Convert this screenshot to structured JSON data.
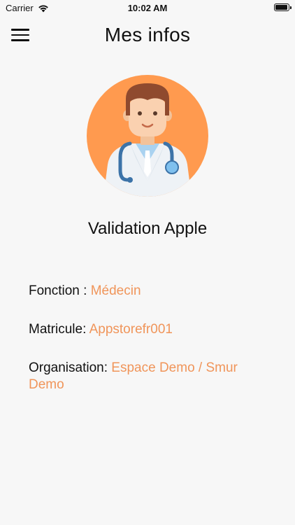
{
  "status_bar": {
    "carrier": "Carrier",
    "time": "10:02 AM"
  },
  "header": {
    "title": "Mes infos",
    "menu_icon": "hamburger-menu-icon"
  },
  "profile": {
    "avatar_icon": "doctor-avatar-icon",
    "name": "Validation Apple"
  },
  "info": {
    "fonction_label": "Fonction : ",
    "fonction_value": "Médecin",
    "matricule_label": "Matricule: ",
    "matricule_value": "Appstorefr001",
    "organisation_label": "Organisation: ",
    "organisation_value": "Espace Demo / Smur Demo"
  },
  "colors": {
    "accent": "#f0955a",
    "avatar_bg": "#ff9a4f",
    "background": "#f7f7f7"
  }
}
